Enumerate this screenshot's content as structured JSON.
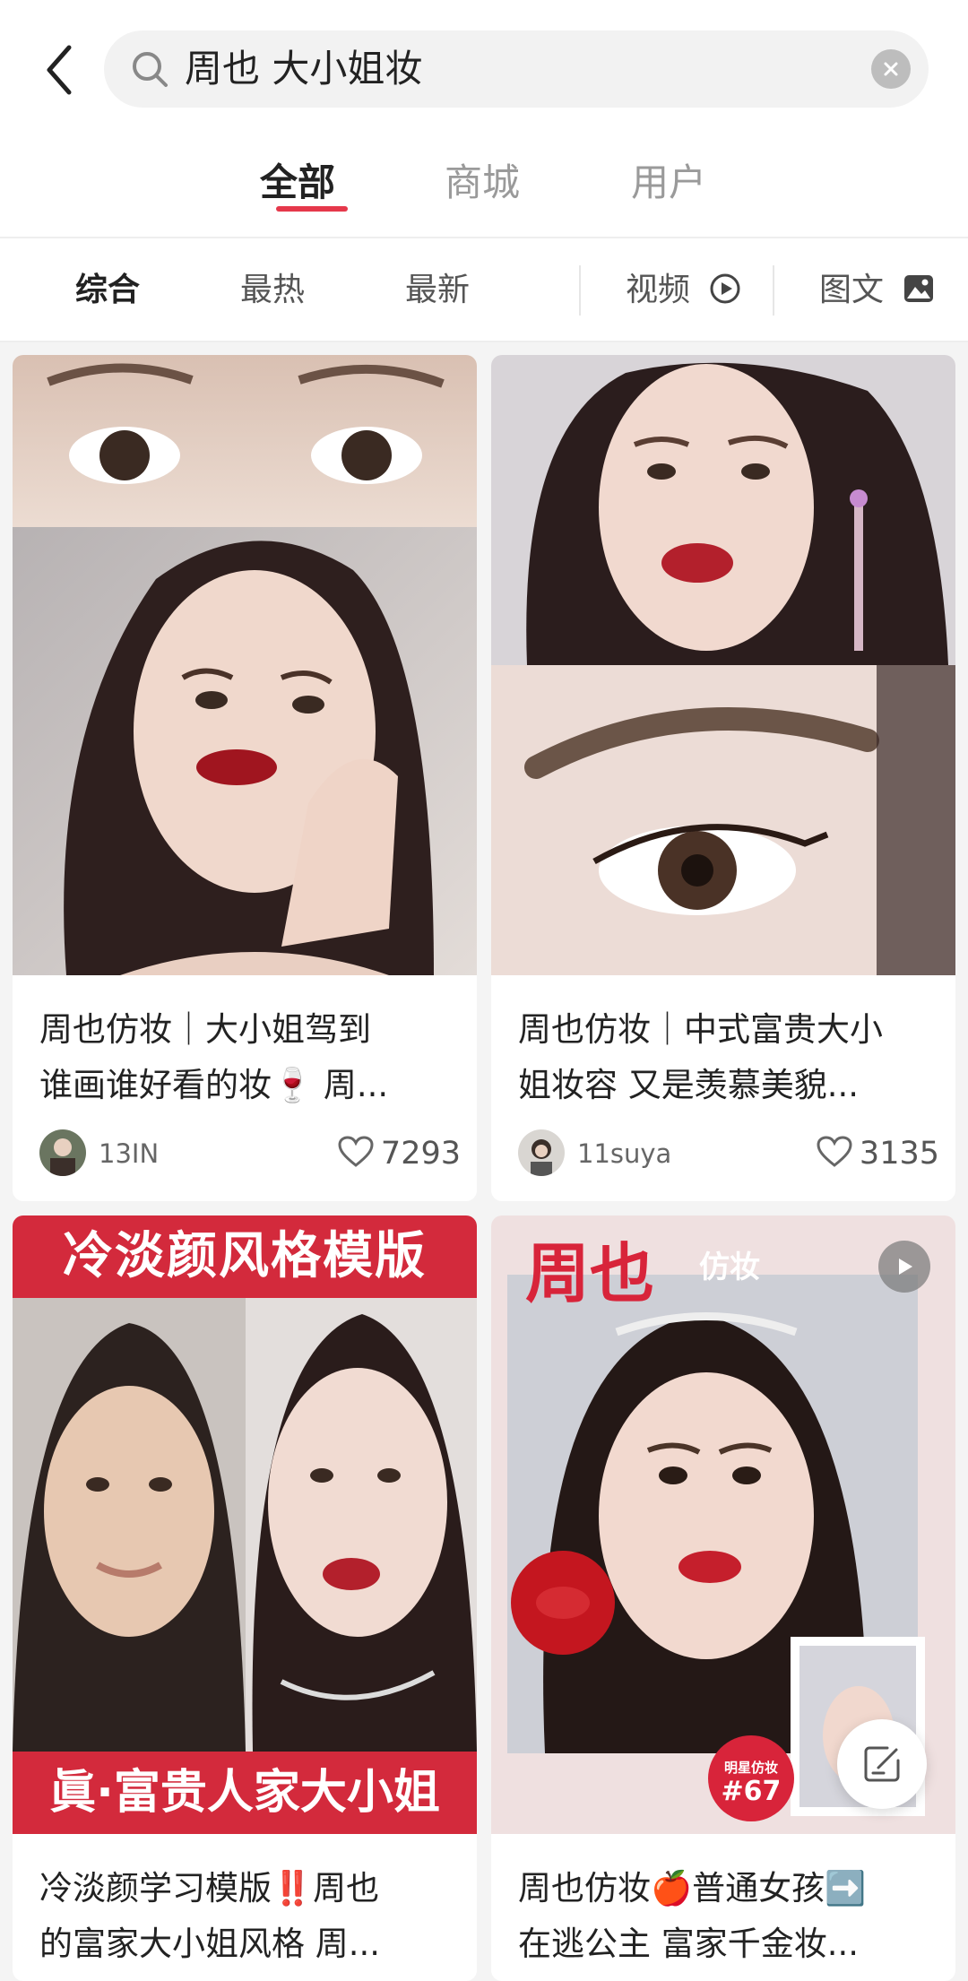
{
  "search": {
    "query": "周也 大小姐妆"
  },
  "tabs": [
    {
      "label": "全部",
      "active": true
    },
    {
      "label": "商城",
      "active": false
    },
    {
      "label": "用户",
      "active": false
    }
  ],
  "filters": {
    "sort": [
      {
        "label": "综合",
        "active": true
      },
      {
        "label": "最热",
        "active": false
      },
      {
        "label": "最新",
        "active": false
      }
    ],
    "video_label": "视频",
    "image_label": "图文"
  },
  "cards": [
    {
      "title": "周也仿妆｜大小姐驾到\n谁画谁好看的妆🍷 周...",
      "user": "13IN",
      "likes": "7293"
    },
    {
      "title": "周也仿妆｜中式富贵大小\n姐妆容 又是羡慕美貌...",
      "user": "11suya",
      "likes": "3135"
    },
    {
      "title": "冷淡颜学习模版‼️周也\n的富家大小姐风格 周...",
      "banner_top": "冷淡颜风格模版",
      "banner_bottom": "眞·富贵人家大小姐"
    },
    {
      "title": "周也仿妆🍎普通女孩➡️\n在逃公主 富家千金妆...",
      "overlay_big": "周也",
      "overlay_small": "仿妆",
      "badge_top": "明星仿妆",
      "badge_num": "#67"
    }
  ],
  "colors": {
    "accent": "#e5384b",
    "badge_red": "#d8243a"
  }
}
